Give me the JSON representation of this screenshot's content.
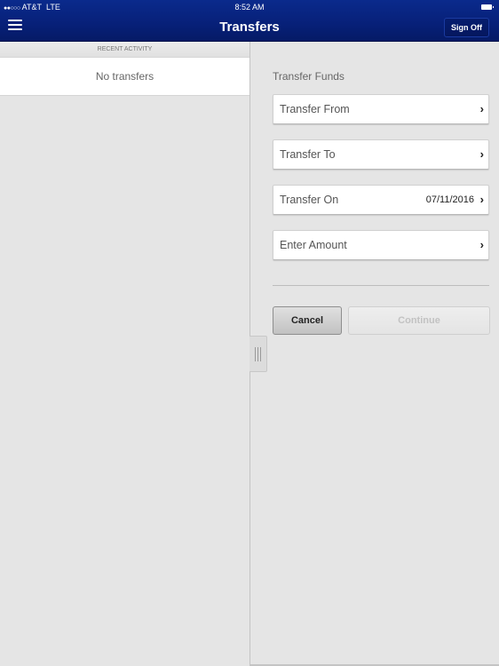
{
  "status_bar": {
    "signal": "●●○○○",
    "carrier": "AT&T",
    "network": "LTE",
    "time": "8:52 AM",
    "battery_icon": "battery-icon"
  },
  "header": {
    "menu_icon": "hamburger-menu-icon",
    "title": "Transfers",
    "sign_off_label": "Sign Off"
  },
  "recent_activity": {
    "header": "RECENT ACTIVITY",
    "empty_message": "No transfers"
  },
  "transfer_form": {
    "title": "Transfer Funds",
    "fields": [
      {
        "label": "Transfer From",
        "value": ""
      },
      {
        "label": "Transfer To",
        "value": ""
      },
      {
        "label": "Transfer On",
        "value": "07/11/2016"
      },
      {
        "label": "Enter Amount",
        "value": ""
      }
    ],
    "chevron": "›",
    "cancel_label": "Cancel",
    "continue_label": "Continue"
  },
  "colors": {
    "header_blue": "#072078",
    "background": "#e5e5e5"
  }
}
